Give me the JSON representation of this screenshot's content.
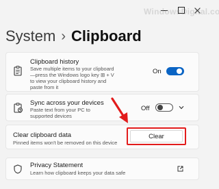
{
  "window": {
    "watermark": "WindowsDigital.com"
  },
  "breadcrumb": {
    "parent": "System",
    "separator": "›",
    "current": "Clipboard"
  },
  "history": {
    "title": "Clipboard history",
    "description_lines": [
      "Save multiple items to your clipboard",
      "—press the Windows logo key ⊞ + V",
      "to view your clipboard history and",
      "paste from it"
    ],
    "state": "On",
    "toggle_on": true,
    "icon": "clipboard-history-icon"
  },
  "sync": {
    "title": "Sync across your devices",
    "description_lines": [
      "Paste text from your PC to",
      "supported devices"
    ],
    "state": "Off",
    "toggle_on": false,
    "icon": "clipboard-sync-icon"
  },
  "clear": {
    "title": "Clear clipboard data",
    "description": "Pinned items won't be removed on this device",
    "button_label": "Clear"
  },
  "privacy": {
    "title": "Privacy Statement",
    "description": "Learn how clipboard keeps your data safe",
    "icon": "shield-icon",
    "link_icon": "open-external-icon"
  },
  "colors": {
    "accent": "#0a64c4",
    "annotation": "#e21b1b"
  }
}
